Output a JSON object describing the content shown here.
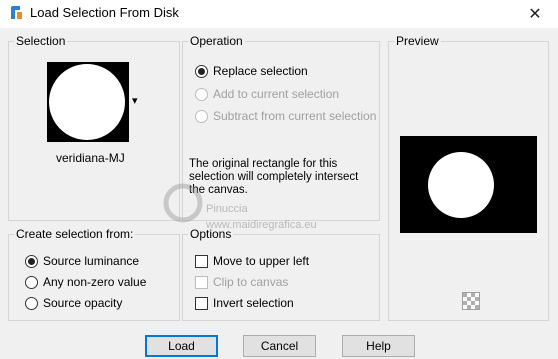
{
  "window": {
    "title": "Load Selection From Disk",
    "close_glyph": "✕"
  },
  "selection": {
    "label": "Selection",
    "file_name": "veridiana-MJ",
    "dropdown_glyph": "▾"
  },
  "operation": {
    "label": "Operation",
    "options": [
      {
        "label": "Replace selection",
        "checked": true,
        "enabled": true
      },
      {
        "label": "Add to current selection",
        "checked": false,
        "enabled": false
      },
      {
        "label": "Subtract from current selection",
        "checked": false,
        "enabled": false
      }
    ],
    "message": "The original rectangle for this selection will completely intersect the canvas."
  },
  "preview": {
    "label": "Preview"
  },
  "create_from": {
    "label": "Create selection from:",
    "options": [
      {
        "label": "Source luminance",
        "checked": true
      },
      {
        "label": "Any non-zero value",
        "checked": false
      },
      {
        "label": "Source opacity",
        "checked": false
      }
    ]
  },
  "options": {
    "label": "Options",
    "items": [
      {
        "label": "Move to upper left",
        "checked": false,
        "enabled": true
      },
      {
        "label": "Clip to canvas",
        "checked": false,
        "enabled": false
      },
      {
        "label": "Invert selection",
        "checked": false,
        "enabled": true
      }
    ]
  },
  "buttons": {
    "load": "Load",
    "cancel": "Cancel",
    "help": "Help"
  },
  "watermark": {
    "line1": "Pinuccia",
    "line2": "www.maidiregrafica.eu"
  }
}
